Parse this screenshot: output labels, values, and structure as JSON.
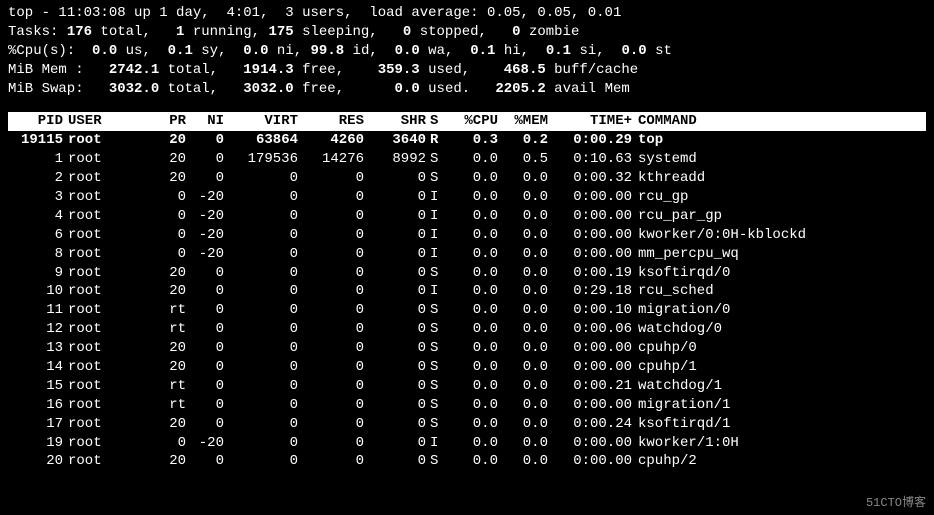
{
  "summary": {
    "line1_pre": "top - ",
    "time": "11:03:08",
    "up_pre": " up ",
    "up": "1 day,  4:01",
    "users_pre": ",  ",
    "users": "3 users",
    "load_pre": ",  load average: ",
    "load": "0.05, 0.05, 0.01"
  },
  "tasks": {
    "label": "Tasks: ",
    "total": "176",
    "total_lbl": " total,   ",
    "running": "1",
    "running_lbl": " running, ",
    "sleeping": "175",
    "sleeping_lbl": " sleeping,   ",
    "stopped": "0",
    "stopped_lbl": " stopped,   ",
    "zombie": "0",
    "zombie_lbl": " zombie"
  },
  "cpu": {
    "label": "%Cpu(s):  ",
    "us": "0.0",
    "us_lbl": " us,  ",
    "sy": "0.1",
    "sy_lbl": " sy,  ",
    "ni": "0.0",
    "ni_lbl": " ni, ",
    "id": "99.8",
    "id_lbl": " id,  ",
    "wa": "0.0",
    "wa_lbl": " wa,  ",
    "hi": "0.1",
    "hi_lbl": " hi,  ",
    "si": "0.1",
    "si_lbl": " si,  ",
    "st": "0.0",
    "st_lbl": " st"
  },
  "mem": {
    "label": "MiB Mem :   ",
    "total": "2742.1",
    "total_lbl": " total,   ",
    "free": "1914.3",
    "free_lbl": " free,    ",
    "used": "359.3",
    "used_lbl": " used,    ",
    "buff": "468.5",
    "buff_lbl": " buff/cache"
  },
  "swap": {
    "label": "MiB Swap:   ",
    "total": "3032.0",
    "total_lbl": " total,   ",
    "free": "3032.0",
    "free_lbl": " free,      ",
    "used": "0.0",
    "used_lbl": " used.   ",
    "avail": "2205.2",
    "avail_lbl": " avail Mem"
  },
  "headers": {
    "pid": "PID",
    "user": "USER",
    "pr": "PR",
    "ni": "NI",
    "virt": "VIRT",
    "res": "RES",
    "shr": "SHR",
    "s": "S",
    "cpu": "%CPU",
    "mem": "%MEM",
    "time": "TIME+",
    "cmd": "COMMAND"
  },
  "rows": [
    {
      "pid": "19115",
      "user": "root",
      "pr": "20",
      "ni": "0",
      "virt": "63864",
      "res": "4260",
      "shr": "3640",
      "s": "R",
      "cpu": "0.3",
      "mem": "0.2",
      "time": "0:00.29",
      "cmd": "top",
      "bold": true
    },
    {
      "pid": "1",
      "user": "root",
      "pr": "20",
      "ni": "0",
      "virt": "179536",
      "res": "14276",
      "shr": "8992",
      "s": "S",
      "cpu": "0.0",
      "mem": "0.5",
      "time": "0:10.63",
      "cmd": "systemd"
    },
    {
      "pid": "2",
      "user": "root",
      "pr": "20",
      "ni": "0",
      "virt": "0",
      "res": "0",
      "shr": "0",
      "s": "S",
      "cpu": "0.0",
      "mem": "0.0",
      "time": "0:00.32",
      "cmd": "kthreadd"
    },
    {
      "pid": "3",
      "user": "root",
      "pr": "0",
      "ni": "-20",
      "virt": "0",
      "res": "0",
      "shr": "0",
      "s": "I",
      "cpu": "0.0",
      "mem": "0.0",
      "time": "0:00.00",
      "cmd": "rcu_gp"
    },
    {
      "pid": "4",
      "user": "root",
      "pr": "0",
      "ni": "-20",
      "virt": "0",
      "res": "0",
      "shr": "0",
      "s": "I",
      "cpu": "0.0",
      "mem": "0.0",
      "time": "0:00.00",
      "cmd": "rcu_par_gp"
    },
    {
      "pid": "6",
      "user": "root",
      "pr": "0",
      "ni": "-20",
      "virt": "0",
      "res": "0",
      "shr": "0",
      "s": "I",
      "cpu": "0.0",
      "mem": "0.0",
      "time": "0:00.00",
      "cmd": "kworker/0:0H-kblockd"
    },
    {
      "pid": "8",
      "user": "root",
      "pr": "0",
      "ni": "-20",
      "virt": "0",
      "res": "0",
      "shr": "0",
      "s": "I",
      "cpu": "0.0",
      "mem": "0.0",
      "time": "0:00.00",
      "cmd": "mm_percpu_wq"
    },
    {
      "pid": "9",
      "user": "root",
      "pr": "20",
      "ni": "0",
      "virt": "0",
      "res": "0",
      "shr": "0",
      "s": "S",
      "cpu": "0.0",
      "mem": "0.0",
      "time": "0:00.19",
      "cmd": "ksoftirqd/0"
    },
    {
      "pid": "10",
      "user": "root",
      "pr": "20",
      "ni": "0",
      "virt": "0",
      "res": "0",
      "shr": "0",
      "s": "I",
      "cpu": "0.0",
      "mem": "0.0",
      "time": "0:29.18",
      "cmd": "rcu_sched"
    },
    {
      "pid": "11",
      "user": "root",
      "pr": "rt",
      "ni": "0",
      "virt": "0",
      "res": "0",
      "shr": "0",
      "s": "S",
      "cpu": "0.0",
      "mem": "0.0",
      "time": "0:00.10",
      "cmd": "migration/0"
    },
    {
      "pid": "12",
      "user": "root",
      "pr": "rt",
      "ni": "0",
      "virt": "0",
      "res": "0",
      "shr": "0",
      "s": "S",
      "cpu": "0.0",
      "mem": "0.0",
      "time": "0:00.06",
      "cmd": "watchdog/0"
    },
    {
      "pid": "13",
      "user": "root",
      "pr": "20",
      "ni": "0",
      "virt": "0",
      "res": "0",
      "shr": "0",
      "s": "S",
      "cpu": "0.0",
      "mem": "0.0",
      "time": "0:00.00",
      "cmd": "cpuhp/0"
    },
    {
      "pid": "14",
      "user": "root",
      "pr": "20",
      "ni": "0",
      "virt": "0",
      "res": "0",
      "shr": "0",
      "s": "S",
      "cpu": "0.0",
      "mem": "0.0",
      "time": "0:00.00",
      "cmd": "cpuhp/1"
    },
    {
      "pid": "15",
      "user": "root",
      "pr": "rt",
      "ni": "0",
      "virt": "0",
      "res": "0",
      "shr": "0",
      "s": "S",
      "cpu": "0.0",
      "mem": "0.0",
      "time": "0:00.21",
      "cmd": "watchdog/1"
    },
    {
      "pid": "16",
      "user": "root",
      "pr": "rt",
      "ni": "0",
      "virt": "0",
      "res": "0",
      "shr": "0",
      "s": "S",
      "cpu": "0.0",
      "mem": "0.0",
      "time": "0:00.00",
      "cmd": "migration/1"
    },
    {
      "pid": "17",
      "user": "root",
      "pr": "20",
      "ni": "0",
      "virt": "0",
      "res": "0",
      "shr": "0",
      "s": "S",
      "cpu": "0.0",
      "mem": "0.0",
      "time": "0:00.24",
      "cmd": "ksoftirqd/1"
    },
    {
      "pid": "19",
      "user": "root",
      "pr": "0",
      "ni": "-20",
      "virt": "0",
      "res": "0",
      "shr": "0",
      "s": "I",
      "cpu": "0.0",
      "mem": "0.0",
      "time": "0:00.00",
      "cmd": "kworker/1:0H"
    },
    {
      "pid": "20",
      "user": "root",
      "pr": "20",
      "ni": "0",
      "virt": "0",
      "res": "0",
      "shr": "0",
      "s": "S",
      "cpu": "0.0",
      "mem": "0.0",
      "time": "0:00.00",
      "cmd": "cpuhp/2"
    }
  ],
  "watermark": "51CTO博客"
}
